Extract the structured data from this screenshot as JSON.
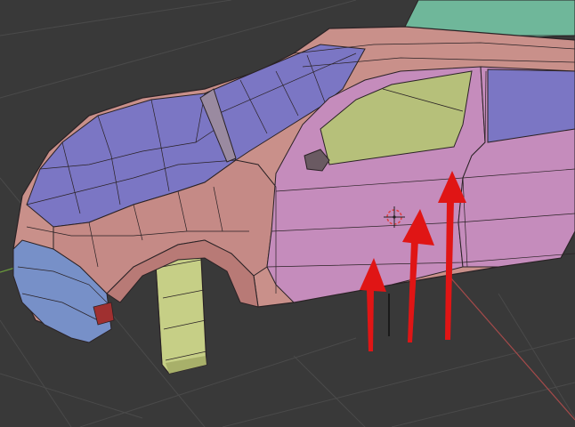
{
  "viewport": {
    "background": "#393939",
    "grid_color": "#4a4a4a",
    "x_axis_color": "#a34a4a",
    "y_axis_color": "#6a9a3c"
  },
  "model": {
    "body_color": "#c9908a",
    "hood_color": "#7b76c4",
    "side_panel_color": "#c58cbc",
    "window_color": "#b6c07a",
    "roof_rack_color": "#6fb79a",
    "tire_color": "#c6cf86",
    "bumper_color": "#7790c8",
    "edge_color": "#2a2225"
  },
  "annotations": {
    "arrow_color": "#e01515",
    "arrow_count": 3
  },
  "cursor_3d": {
    "color": "#e04040"
  }
}
